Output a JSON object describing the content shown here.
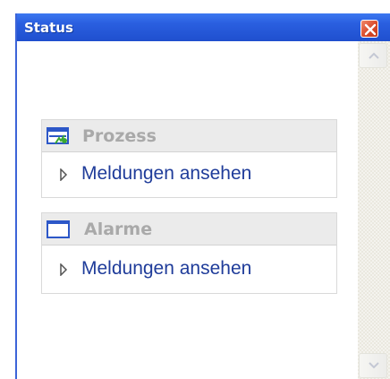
{
  "window": {
    "title": "Status"
  },
  "panels": [
    {
      "title": "Prozess",
      "icon": "process-monitor-icon",
      "item_label": "Meldungen ansehen"
    },
    {
      "title": "Alarme",
      "icon": "alarm-window-icon",
      "item_label": "Meldungen ansehen"
    }
  ],
  "colors": {
    "titlebar": "#2a5fe0",
    "close": "#d94a2a",
    "panel_header": "#ebebeb",
    "panel_title": "#a9a9a9",
    "link": "#1f3c9a"
  }
}
